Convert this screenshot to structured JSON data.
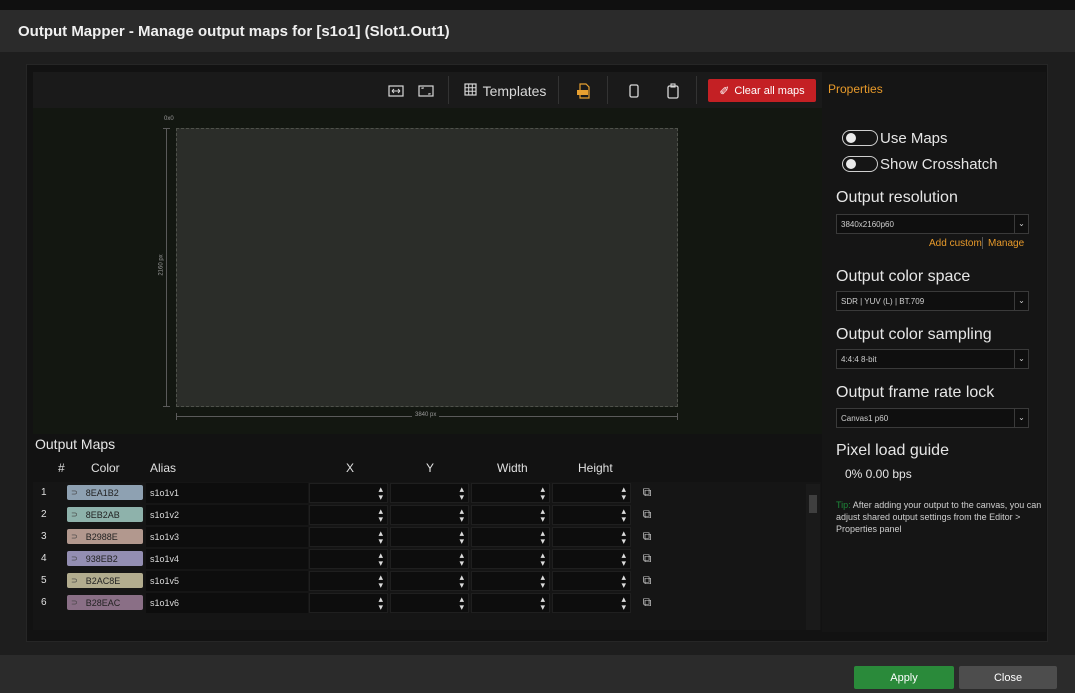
{
  "window": {
    "title": "Output Mapper - Manage output maps for [s1o1] (Slot1.Out1)"
  },
  "toolbar": {
    "templates_label": "Templates",
    "clear_label": "Clear all maps"
  },
  "canvas": {
    "origin_label": "0x0",
    "width_label": "3840 px",
    "height_label": "2160 px"
  },
  "maps": {
    "title": "Output Maps",
    "columns": [
      "#",
      "Color",
      "Alias",
      "X",
      "Y",
      "Width",
      "Height"
    ],
    "rows": [
      {
        "num": "1",
        "color_hex": "8EA1B2",
        "color": "#8ea1b2",
        "alias": "s1o1v1"
      },
      {
        "num": "2",
        "color_hex": "8EB2AB",
        "color": "#8eb2ab",
        "alias": "s1o1v2"
      },
      {
        "num": "3",
        "color_hex": "B2988E",
        "color": "#b2988e",
        "alias": "s1o1v3"
      },
      {
        "num": "4",
        "color_hex": "938EB2",
        "color": "#938eb2",
        "alias": "s1o1v4"
      },
      {
        "num": "5",
        "color_hex": "B2AC8E",
        "color": "#b2ac8e",
        "alias": "s1o1v5"
      },
      {
        "num": "6",
        "color_hex": "B28EAC",
        "color": "#8a6f86",
        "alias": "s1o1v6"
      }
    ]
  },
  "properties": {
    "tab_label": "Properties",
    "use_maps_label": "Use Maps",
    "show_crosshatch_label": "Show Crosshatch",
    "resolution": {
      "label": "Output resolution",
      "value": "3840x2160p60",
      "add_custom": "Add custom",
      "manage": "Manage"
    },
    "color_space": {
      "label": "Output color space",
      "value": "SDR | YUV (L) | BT.709"
    },
    "color_sampling": {
      "label": "Output color sampling",
      "value": "4:4:4 8-bit"
    },
    "frame_rate_lock": {
      "label": "Output frame rate lock",
      "value": "Canvas1 p60"
    },
    "pixel_load": {
      "label": "Pixel load guide",
      "value": "0%  0.00 bps"
    },
    "tip_label": "Tip:",
    "tip_text": "After adding your output to the canvas, you can adjust shared output settings from the Editor > Properties panel"
  },
  "footer": {
    "apply_label": "Apply",
    "close_label": "Close"
  },
  "colors": {
    "accent": "#e89a2a",
    "danger": "#c42024",
    "apply": "#2a8a3a"
  }
}
